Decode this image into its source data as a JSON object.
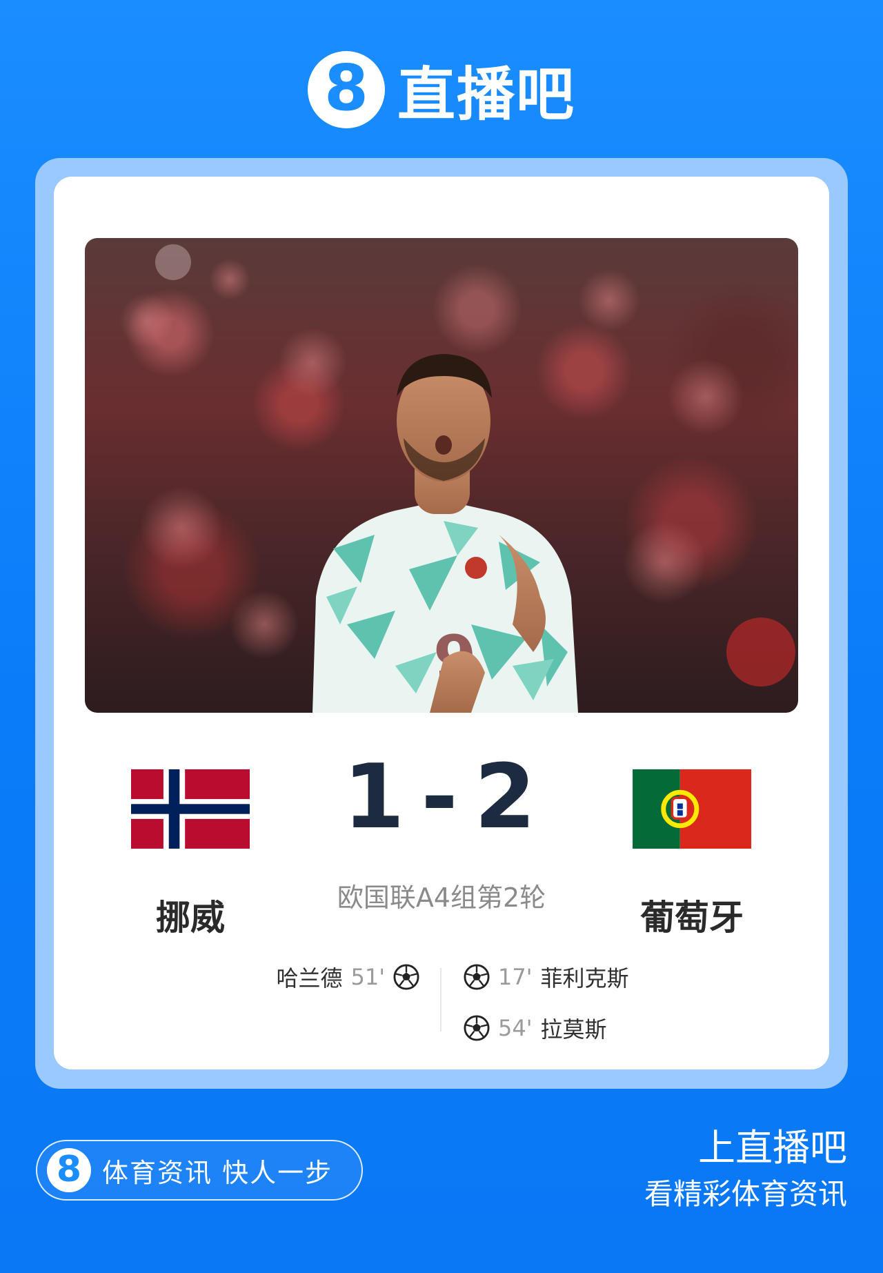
{
  "header": {
    "logo_glyph": "8",
    "brand": "直播吧"
  },
  "match": {
    "home": {
      "name": "挪威",
      "flag": "norway-flag"
    },
    "away": {
      "name": "葡萄牙",
      "flag": "portugal-flag"
    },
    "score": {
      "home": "1",
      "separator": "-",
      "away": "2"
    },
    "competition": "欧国联A4组第2轮",
    "goals": {
      "home": [
        {
          "scorer": "哈兰德",
          "minute": "51'"
        }
      ],
      "away": [
        {
          "scorer": "菲利克斯",
          "minute": "17'"
        },
        {
          "scorer": "拉莫斯",
          "minute": "54'"
        }
      ]
    }
  },
  "footer": {
    "pill_glyph": "8",
    "slogan": "体育资讯 快人一步",
    "cta_line1": "上直播吧",
    "cta_line2": "看精彩体育资讯"
  },
  "colors": {
    "background": "#0a7cf9",
    "frame": "#9ac9ff",
    "score_text": "#1c2b3f",
    "norway_red": "#ba0c2f",
    "norway_blue": "#00205b",
    "portugal_green": "#046a38",
    "portugal_red": "#da291c"
  }
}
